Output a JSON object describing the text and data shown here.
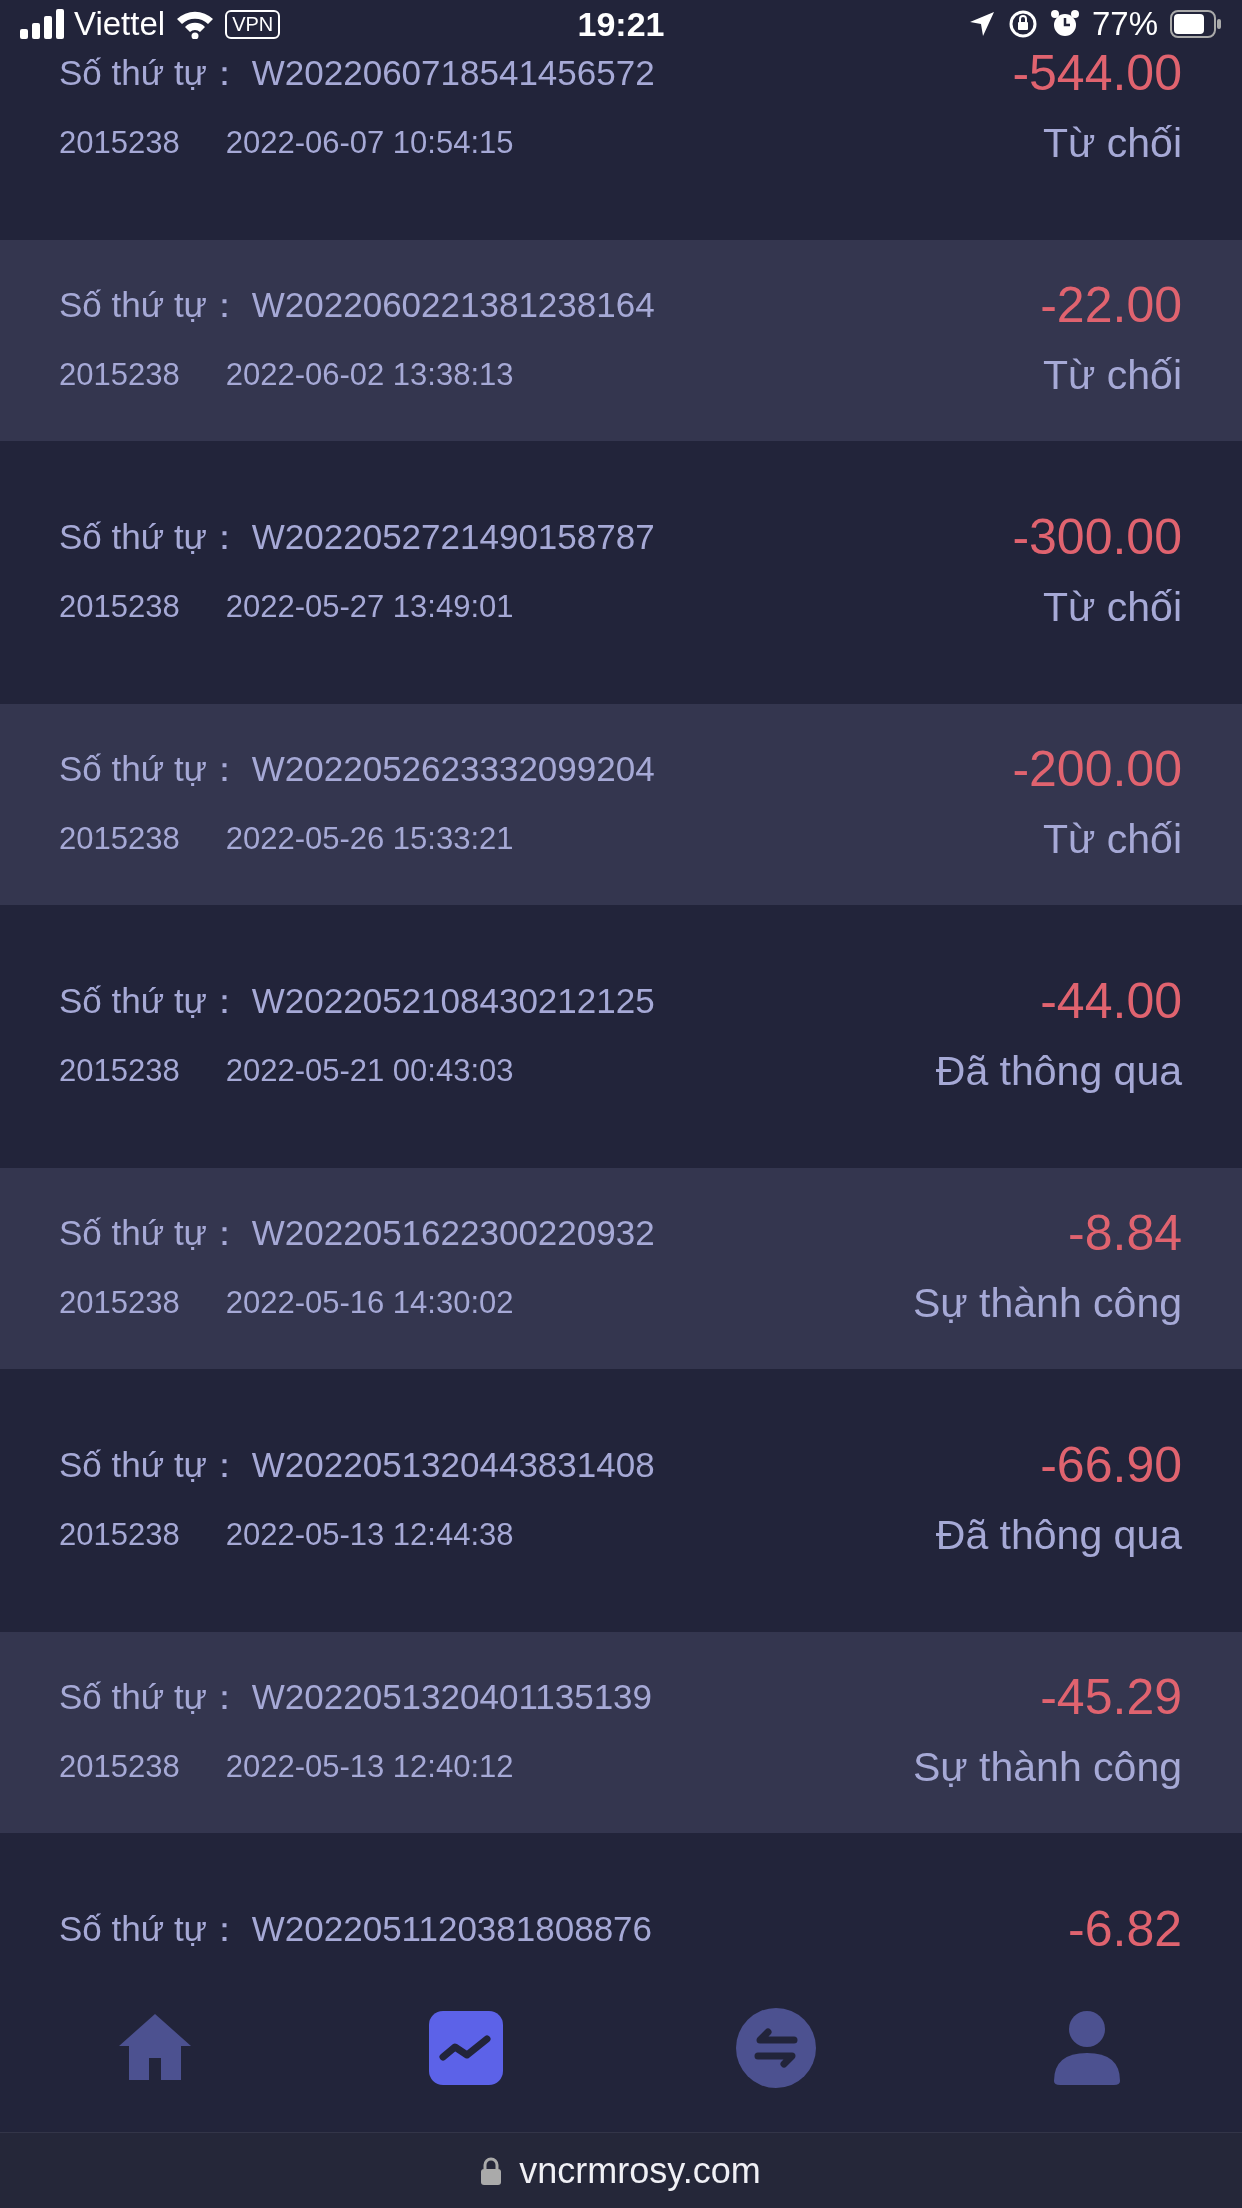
{
  "status_bar": {
    "carrier": "Viettel",
    "vpn": "VPN",
    "time": "19:21",
    "battery": "77%"
  },
  "records": [
    {
      "label": "Số thứ tự：",
      "order_no": "W2022060718541456572",
      "user_id": "2015238",
      "datetime": "2022-06-07 10:54:15",
      "amount": "-544.00",
      "status": "Từ chối"
    },
    {
      "label": "Số thứ tự：",
      "order_no": "W2022060221381238164",
      "user_id": "2015238",
      "datetime": "2022-06-02 13:38:13",
      "amount": "-22.00",
      "status": "Từ chối"
    },
    {
      "label": "Số thứ tự：",
      "order_no": "W2022052721490158787",
      "user_id": "2015238",
      "datetime": "2022-05-27 13:49:01",
      "amount": "-300.00",
      "status": "Từ chối"
    },
    {
      "label": "Số thứ tự：",
      "order_no": "W2022052623332099204",
      "user_id": "2015238",
      "datetime": "2022-05-26 15:33:21",
      "amount": "-200.00",
      "status": "Từ chối"
    },
    {
      "label": "Số thứ tự：",
      "order_no": "W2022052108430212125",
      "user_id": "2015238",
      "datetime": "2022-05-21 00:43:03",
      "amount": "-44.00",
      "status": "Đã thông qua"
    },
    {
      "label": "Số thứ tự：",
      "order_no": "W2022051622300220932",
      "user_id": "2015238",
      "datetime": "2022-05-16 14:30:02",
      "amount": "-8.84",
      "status": "Sự thành công"
    },
    {
      "label": "Số thứ tự：",
      "order_no": "W2022051320443831408",
      "user_id": "2015238",
      "datetime": "2022-05-13 12:44:38",
      "amount": "-66.90",
      "status": "Đã thông qua"
    },
    {
      "label": "Số thứ tự：",
      "order_no": "W2022051320401135139",
      "user_id": "2015238",
      "datetime": "2022-05-13 12:40:12",
      "amount": "-45.29",
      "status": "Sự thành công"
    },
    {
      "label": "Số thứ tự：",
      "order_no": "W2022051120381808876",
      "amount": "-6.82"
    }
  ],
  "tab_bar": [
    {
      "kind": "home",
      "selected": false
    },
    {
      "kind": "chart",
      "selected": true
    },
    {
      "kind": "exchange",
      "selected": false
    },
    {
      "kind": "profile",
      "selected": false
    }
  ],
  "url_bar": {
    "url": "vncrmrosy.com"
  }
}
